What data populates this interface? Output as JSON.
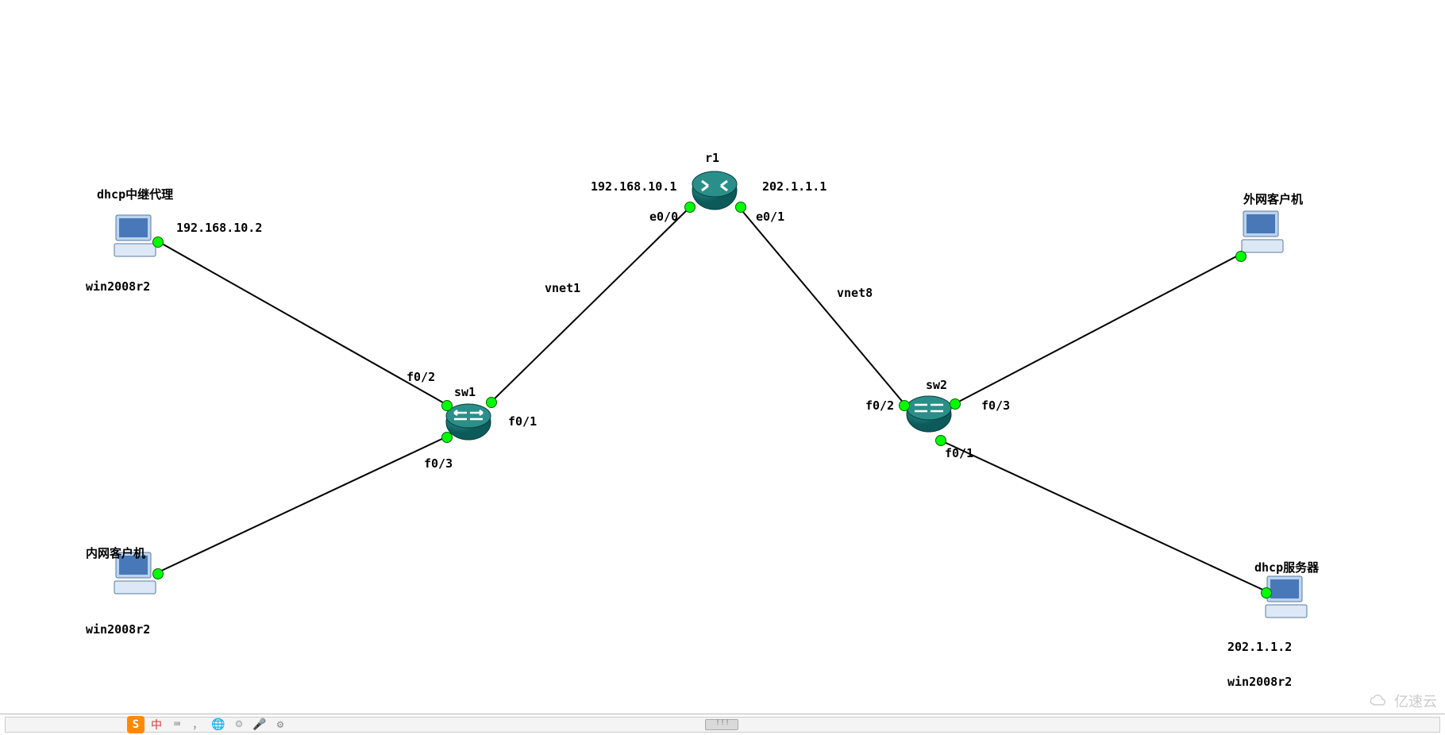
{
  "nodes": {
    "r1": {
      "name": "r1",
      "ip_left": "192.168.10.1",
      "ip_right": "202.1.1.1",
      "port_left": "e0/0",
      "port_right": "e0/1"
    },
    "sw1": {
      "name": "sw1",
      "port_up": "f0/1",
      "port_topleft": "f0/2",
      "port_botleft": "f0/3"
    },
    "sw2": {
      "name": "sw2",
      "port_up": "f0/2",
      "port_bot": "f0/1",
      "port_right": "f0/3"
    },
    "pc_tl": {
      "title": "dhcp中继代理",
      "ip": "192.168.10.2",
      "os": "win2008r2"
    },
    "pc_bl": {
      "title": "内网客户机",
      "os": "win2008r2"
    },
    "pc_tr": {
      "title": "外网客户机"
    },
    "pc_br": {
      "title": "dhcp服务器",
      "ip": "202.1.1.2",
      "os": "win2008r2"
    }
  },
  "links": {
    "r1_sw1": "vnet1",
    "r1_sw2": "vnet8"
  },
  "watermark": "亿速云",
  "scrollbar_marker": "!!!"
}
